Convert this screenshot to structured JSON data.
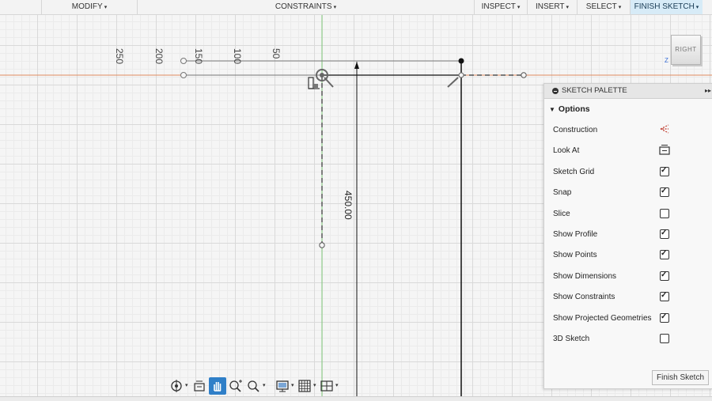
{
  "toolbar": {
    "modify": "MODIFY",
    "constraints": "CONSTRAINTS",
    "inspect": "INSPECT",
    "insert": "INSERT",
    "select": "SELECT",
    "finish_sketch": "FINISH SKETCH",
    "caret": "▾"
  },
  "canvas": {
    "ruler_labels": [
      "250",
      "200",
      "150",
      "100",
      "50"
    ],
    "dimension_label": "450.00"
  },
  "viewcube": {
    "face": "RIGHT",
    "axis": "Z"
  },
  "palette": {
    "title": "SKETCH PALETTE",
    "expand_glyph": "▸▸",
    "section": "Options",
    "rows": [
      {
        "label": "Construction",
        "type": "icon",
        "icon": "construction-icon"
      },
      {
        "label": "Look At",
        "type": "icon",
        "icon": "look-at-icon"
      },
      {
        "label": "Sketch Grid",
        "type": "checkbox",
        "checked": true
      },
      {
        "label": "Snap",
        "type": "checkbox",
        "checked": true
      },
      {
        "label": "Slice",
        "type": "checkbox",
        "checked": false
      },
      {
        "label": "Show Profile",
        "type": "checkbox",
        "checked": true
      },
      {
        "label": "Show Points",
        "type": "checkbox",
        "checked": true
      },
      {
        "label": "Show Dimensions",
        "type": "checkbox",
        "checked": true
      },
      {
        "label": "Show Constraints",
        "type": "checkbox",
        "checked": true
      },
      {
        "label": "Show Projected Geometries",
        "type": "checkbox",
        "checked": true
      },
      {
        "label": "3D Sketch",
        "type": "checkbox",
        "checked": false
      }
    ],
    "finish_button": "Finish Sketch"
  },
  "navbar": {
    "tools": [
      "orbit-icon",
      "look-at-icon",
      "pan-icon",
      "zoom-window-icon",
      "zoom-icon",
      "display-settings-icon",
      "grid-settings-icon",
      "viewports-icon"
    ],
    "active_tool": "pan-icon"
  },
  "colors": {
    "accent": "#2f7fc8",
    "x_axis": "#e08a5f",
    "y_axis": "#7cc576",
    "sketch_line": "#111111"
  }
}
